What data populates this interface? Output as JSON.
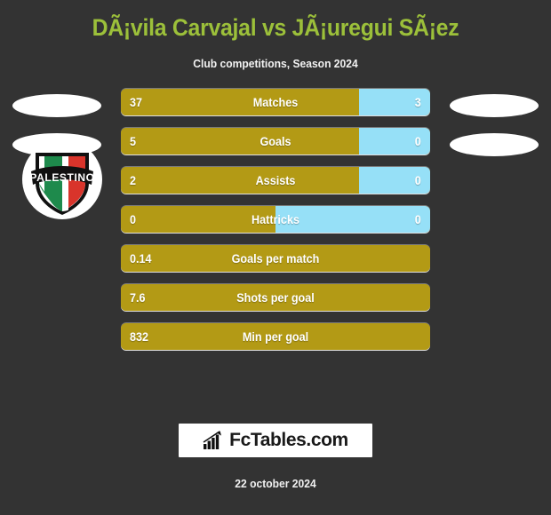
{
  "header": {
    "title": "DÃ¡vila Carvajal vs JÃ¡uregui SÃ¡ez",
    "subtitle": "Club competitions, Season 2024"
  },
  "colors": {
    "background": "#333333",
    "title": "#9CC03A",
    "home_bar": "#B39A15",
    "away_bar": "#96E0F7",
    "text": "#ffffff",
    "badge_green": "#1E8A4C",
    "badge_red": "#D9342B",
    "badge_black": "#111111",
    "badge_white": "#ffffff"
  },
  "club_badge": {
    "name": "Palestino",
    "banner_text": "PALESTINO"
  },
  "stats": [
    {
      "label": "Matches",
      "home": "37",
      "away": "3",
      "home_pct": 77,
      "away_pct": 23,
      "split": true
    },
    {
      "label": "Goals",
      "home": "5",
      "away": "0",
      "home_pct": 77,
      "away_pct": 23,
      "split": true
    },
    {
      "label": "Assists",
      "home": "2",
      "away": "0",
      "home_pct": 77,
      "away_pct": 23,
      "split": true
    },
    {
      "label": "Hattricks",
      "home": "0",
      "away": "0",
      "home_pct": 50,
      "away_pct": 50,
      "split": true
    },
    {
      "label": "Goals per match",
      "home": "0.14",
      "away": "",
      "home_pct": 100,
      "away_pct": 0,
      "split": false
    },
    {
      "label": "Shots per goal",
      "home": "7.6",
      "away": "",
      "home_pct": 100,
      "away_pct": 0,
      "split": false
    },
    {
      "label": "Min per goal",
      "home": "832",
      "away": "",
      "home_pct": 100,
      "away_pct": 0,
      "split": false
    }
  ],
  "footer": {
    "brand": "FcTables.com",
    "brand_icon": "bar-chart-growth-icon",
    "date": "22 october 2024"
  }
}
